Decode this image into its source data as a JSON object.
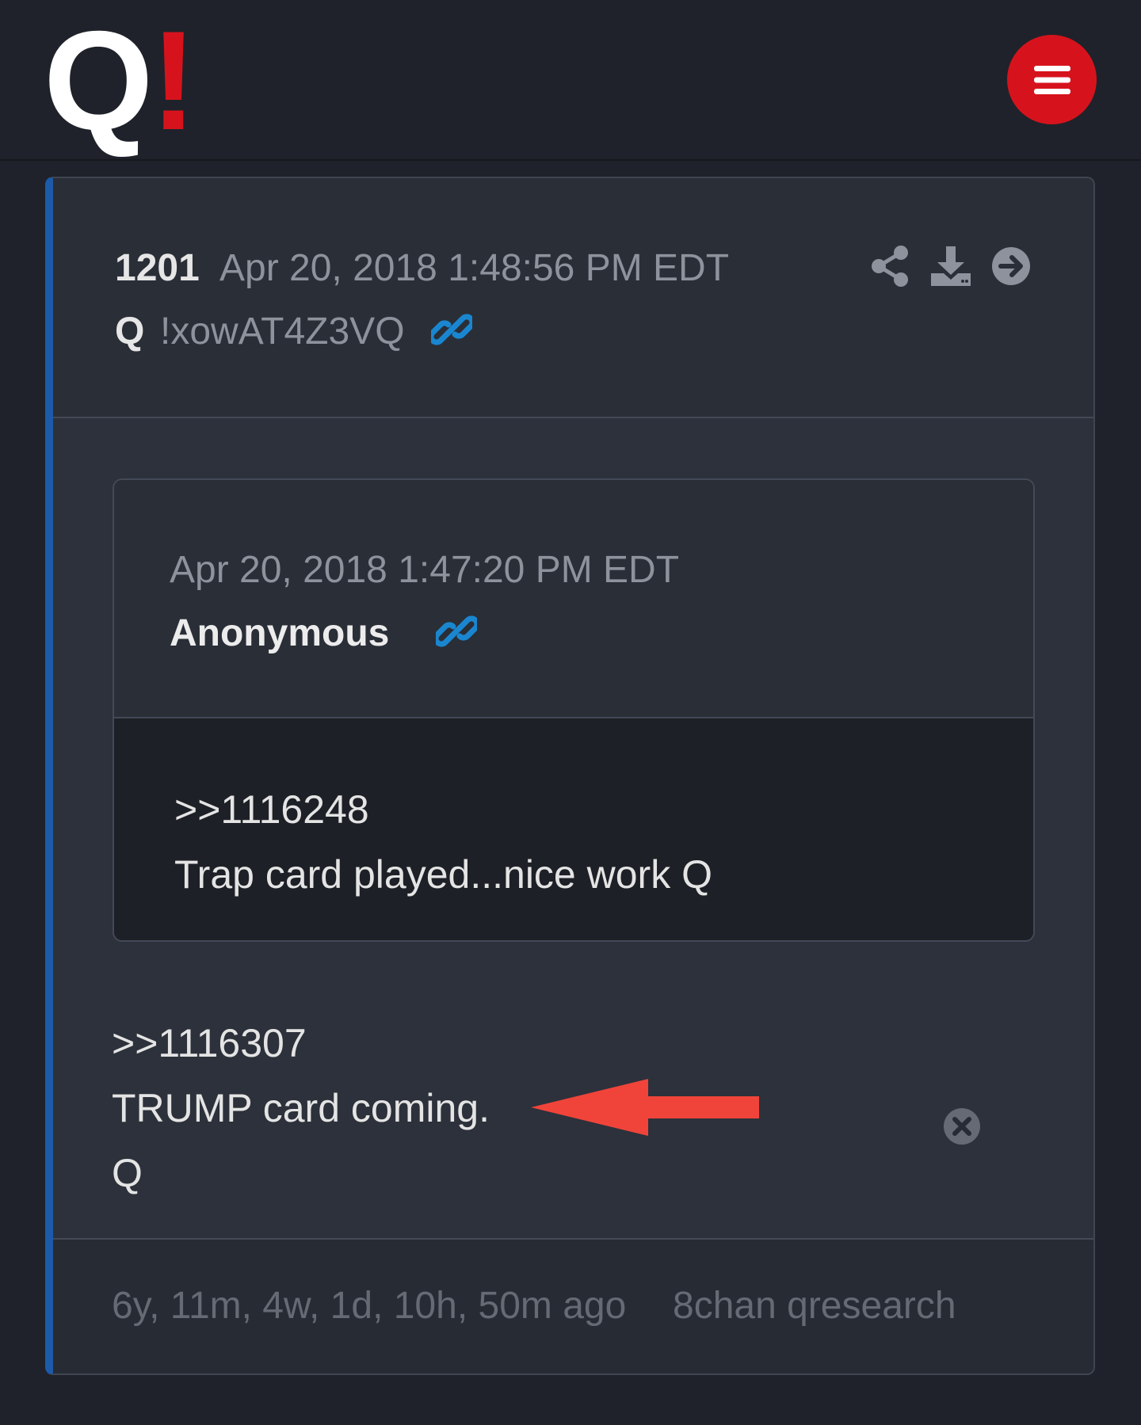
{
  "logo": {
    "q": "Q",
    "bang": "!"
  },
  "header": {
    "menu_icon": "hamburger-menu-icon"
  },
  "post": {
    "number": "1201",
    "date": "Apr 20, 2018 1:48:56 PM EDT",
    "author": "Q",
    "tripcode": "!xowAT4Z3VQ",
    "actions": [
      "share-icon",
      "download-icon",
      "arrow-right-circle-icon"
    ],
    "body_lines": [
      ">>1116307",
      "TRUMP card coming.",
      "Q"
    ]
  },
  "quote": {
    "date": "Apr 20, 2018 1:47:20 PM EDT",
    "author": "Anonymous",
    "body_lines": [
      ">>1116248",
      "Trap card played...nice work Q"
    ]
  },
  "footer": {
    "age": "6y, 11m, 4w, 1d, 10h, 50m ago",
    "source": "8chan qresearch"
  },
  "colors": {
    "accent_red": "#d6131c",
    "link_blue": "#1a86d0",
    "left_border_blue": "#1d5aa8",
    "annotation_arrow": "#f0443a"
  }
}
